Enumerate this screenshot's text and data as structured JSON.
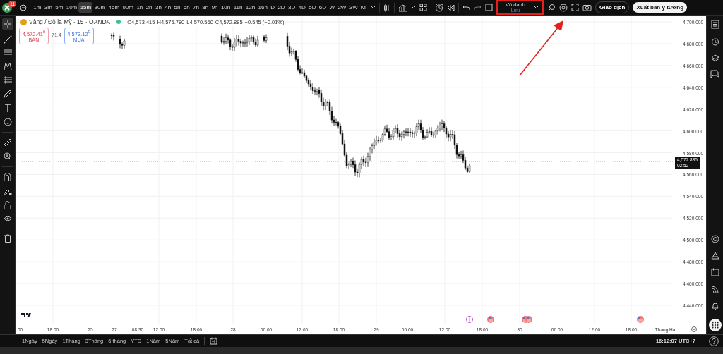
{
  "app_badge": {
    "count": "11"
  },
  "timeframes": [
    {
      "label": "1m",
      "selected": false
    },
    {
      "label": "3m",
      "selected": false
    },
    {
      "label": "5m",
      "selected": false
    },
    {
      "label": "10m",
      "selected": false
    },
    {
      "label": "15m",
      "selected": true
    },
    {
      "label": "30m",
      "selected": false
    },
    {
      "label": "45m",
      "selected": false
    },
    {
      "label": "90m",
      "selected": false
    },
    {
      "label": "1h",
      "selected": false
    },
    {
      "label": "2h",
      "selected": false
    },
    {
      "label": "3h",
      "selected": false
    },
    {
      "label": "4h",
      "selected": false
    },
    {
      "label": "5h",
      "selected": false
    },
    {
      "label": "6h",
      "selected": false
    },
    {
      "label": "7h",
      "selected": false
    },
    {
      "label": "8h",
      "selected": false
    },
    {
      "label": "9h",
      "selected": false
    },
    {
      "label": "10h",
      "selected": false
    },
    {
      "label": "11h",
      "selected": false
    },
    {
      "label": "12h",
      "selected": false
    },
    {
      "label": "16h",
      "selected": false
    },
    {
      "label": "D",
      "selected": false
    },
    {
      "label": "2D",
      "selected": false
    },
    {
      "label": "3D",
      "selected": false
    },
    {
      "label": "4D",
      "selected": false
    },
    {
      "label": "5D",
      "selected": false
    },
    {
      "label": "6D",
      "selected": false
    },
    {
      "label": "W",
      "selected": false
    },
    {
      "label": "2W",
      "selected": false
    },
    {
      "label": "3W",
      "selected": false
    },
    {
      "label": "M",
      "selected": false
    }
  ],
  "layout": {
    "name": "Vô danh",
    "status": "Lưu"
  },
  "buttons": {
    "trade": "Giao dịch",
    "publish": "Xuất bản ý tưởng"
  },
  "legend": {
    "symbol": "Vàng / Đô la Mỹ · 15 · OANDA",
    "open": "O4,573.415",
    "high": "H4,575.780",
    "low": "L4,570.560",
    "close": "C4,572.885",
    "change": "−0.545 (−0.01%)"
  },
  "sell": {
    "price": "4,572.41$^{0}$",
    "label": "BÁN"
  },
  "spread": "71.4",
  "buy": {
    "price": "4,573.12$^{9}$",
    "label": "MUA"
  },
  "price_axis": [
    "4,700.000",
    "4,680.000",
    "4,660.000",
    "4,640.000",
    "4,620.000",
    "4,600.000",
    "4,580.000",
    "4,560.000",
    "4,540.000",
    "4,520.000",
    "4,500.000",
    "4,480.000",
    "4,460.000",
    "4,440.000"
  ],
  "current_price": {
    "price": "4,572.885",
    "countdown": "02:52"
  },
  "time_axis": [
    "00",
    "18:00",
    "25",
    "27",
    "08:30",
    "12:00",
    "18:00",
    "28",
    "06:00",
    "12:00",
    "18:00",
    "29",
    "06:00",
    "12:00",
    "18:00",
    "30",
    "06:00",
    "12:00",
    "18:00",
    "Tháng Ha:"
  ],
  "events": [
    {
      "kind": "dividend"
    },
    {
      "kind": "flag"
    },
    {
      "kind": "flag"
    },
    {
      "kind": "flag"
    },
    {
      "kind": "flag"
    }
  ],
  "ranges": [
    "1Ngày",
    "5Ngày",
    "1Tháng",
    "3Tháng",
    "6 tháng",
    "YTD",
    "1Năm",
    "5Năm",
    "Tất cả"
  ],
  "clock": "16:12:07 UTC+7"
}
